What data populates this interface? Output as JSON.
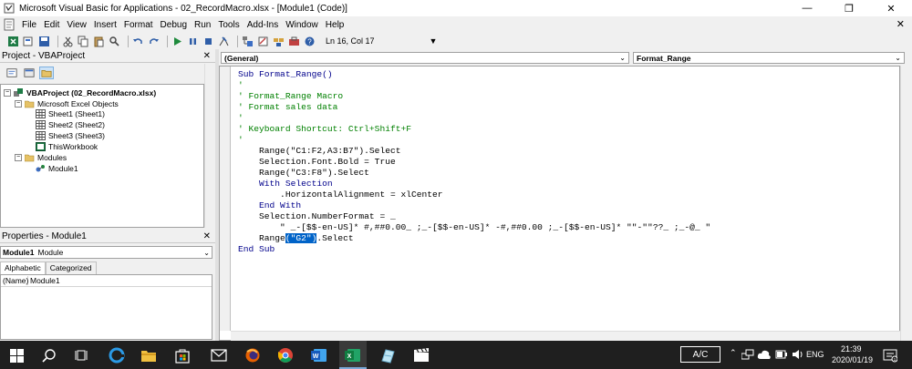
{
  "window": {
    "title": "Microsoft Visual Basic for Applications - 02_RecordMacro.xlsx - [Module1 (Code)]",
    "controls": [
      "minimize-icon",
      "restore-icon",
      "close-icon"
    ]
  },
  "menu": {
    "items": [
      "File",
      "Edit",
      "View",
      "Insert",
      "Format",
      "Debug",
      "Run",
      "Tools",
      "Add-Ins",
      "Window",
      "Help"
    ]
  },
  "toolbar": {
    "position": "Ln 16, Col 17"
  },
  "project": {
    "title": "Project - VBAProject",
    "tree": {
      "root": "VBAProject (02_RecordMacro.xlsx)",
      "excel_objects": "Microsoft Excel Objects",
      "sheets": [
        "Sheet1 (Sheet1)",
        "Sheet2 (Sheet2)",
        "Sheet3 (Sheet3)",
        "ThisWorkbook"
      ],
      "modules": "Modules",
      "module1": "Module1"
    }
  },
  "properties": {
    "title": "Properties - Module1",
    "object_name": "Module1",
    "object_type": "Module",
    "tabs": [
      "Alphabetic",
      "Categorized"
    ],
    "rows": [
      {
        "key": "(Name)",
        "value": "Module1"
      }
    ]
  },
  "code": {
    "object_combo": "(General)",
    "proc_combo": "Format_Range",
    "lines": {
      "l1": "Sub Format_Range()",
      "l2": "'",
      "l3": "' Format_Range Macro",
      "l4": "' Format sales data",
      "l5": "'",
      "l6": "' Keyboard Shortcut: Ctrl+Shift+F",
      "l7": "'",
      "l8": "    Range(\"C1:F2,A3:B7\").Select",
      "l9": "    Selection.Font.Bold = True",
      "l10": "    Range(\"C3:F8\").Select",
      "l11": "    With Selection",
      "l12": "        .HorizontalAlignment = xlCenter",
      "l13": "    End With",
      "l14": "    Selection.NumberFormat = _",
      "l15": "        \" _-[$$-en-US]* #,##0.00_ ;_-[$$-en-US]* -#,##0.00 ;_-[$$-en-US]* \"\"-\"\"??_ ;_-@_ \"",
      "l16_pre": "    Range",
      "l16_sel": "(\"G2\")",
      "l16_post": ".Select",
      "l17": "End Sub"
    }
  },
  "taskbar": {
    "ac": "A/C",
    "lang": "ENG",
    "time": "21:39",
    "date": "2020/01/19"
  },
  "colors": {
    "keyword": "#00008b",
    "comment": "#008000",
    "selection": "#0063c8",
    "taskbar": "#1f1f1f"
  }
}
